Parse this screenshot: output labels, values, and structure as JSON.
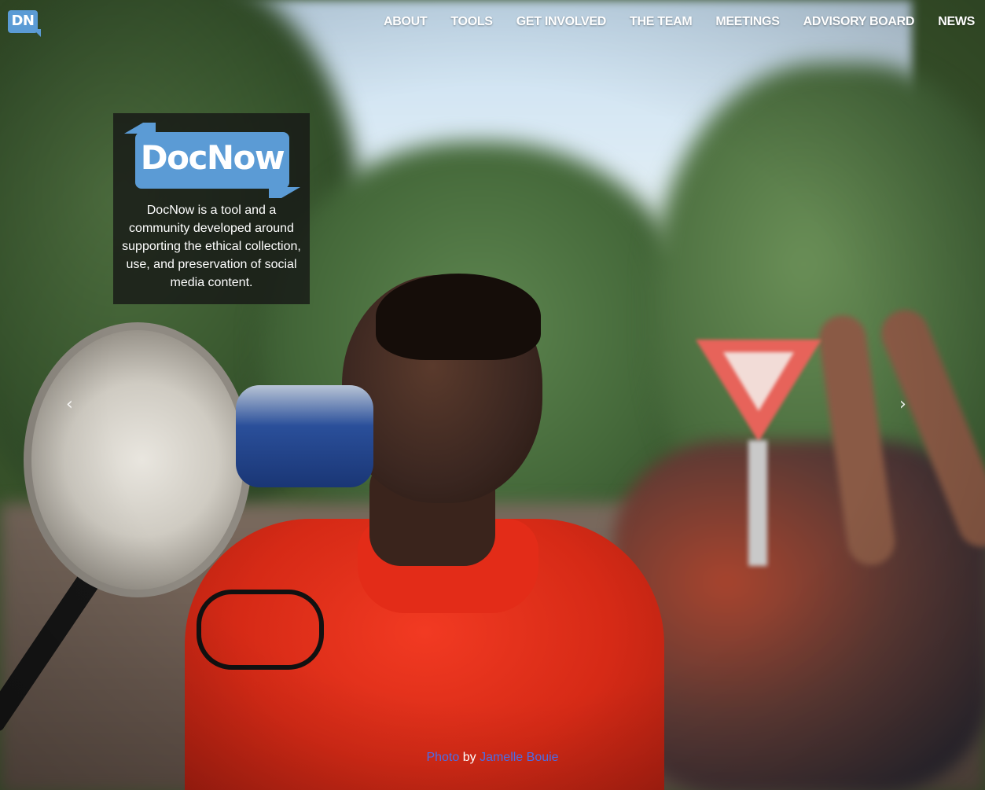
{
  "nav": {
    "logo_text": "DN",
    "items": [
      {
        "label": "ABOUT"
      },
      {
        "label": "TOOLS"
      },
      {
        "label": "GET INVOLVED"
      },
      {
        "label": "THE TEAM"
      },
      {
        "label": "MEETINGS"
      },
      {
        "label": "ADVISORY BOARD"
      },
      {
        "label": "NEWS"
      }
    ]
  },
  "hero": {
    "logo_word": "DocNow",
    "description": "DocNow is a tool and a community developed around supporting the ethical collection, use, and preservation of social media content."
  },
  "carousel": {
    "prev_icon": "chevron-left-icon",
    "next_icon": "chevron-right-icon",
    "prev_glyph": "‹",
    "next_glyph": "›"
  },
  "credit": {
    "photo_label": "Photo",
    "by_text": "by",
    "author": "Jamelle Bouie"
  },
  "colors": {
    "brand_blue": "#5b9bd5",
    "link_blue": "#4a6de8"
  }
}
